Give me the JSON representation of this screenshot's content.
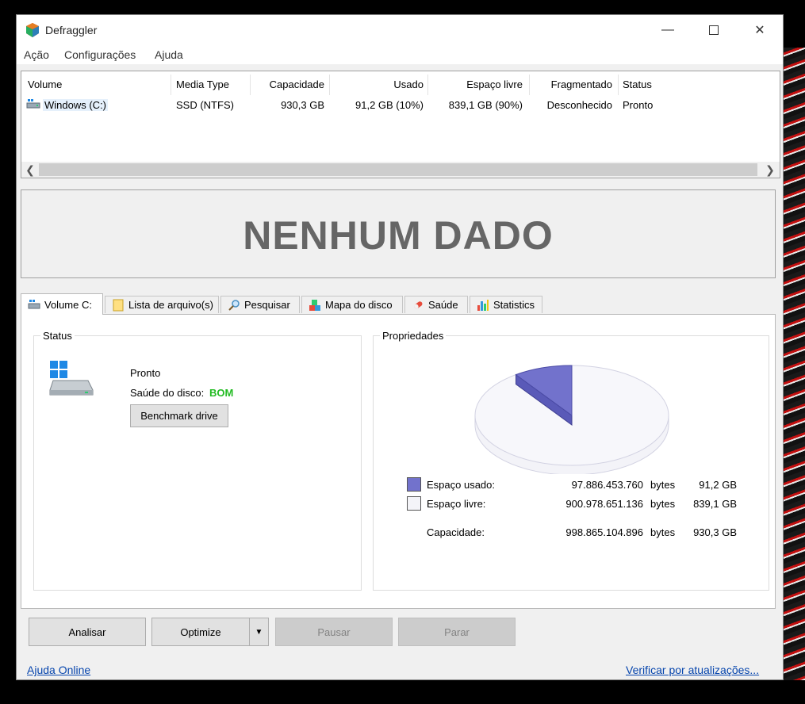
{
  "window": {
    "title": "Defraggler"
  },
  "menu": [
    "Ação",
    "Configurações",
    "Ajuda"
  ],
  "volume_list": {
    "columns": [
      "Volume",
      "Media Type",
      "Capacidade",
      "Usado",
      "Espaço livre",
      "Fragmentado",
      "Status"
    ],
    "rows": [
      {
        "volume": "Windows (C:)",
        "media_type": "SSD (NTFS)",
        "capacity": "930,3 GB",
        "used": "91,2 GB (10%)",
        "free": "839,1 GB (90%)",
        "fragmented": "Desconhecido",
        "status": "Pronto"
      }
    ]
  },
  "drive_map": {
    "message": "NENHUM DADO"
  },
  "tabs": [
    "Volume C:",
    "Lista de arquivo(s)",
    "Pesquisar",
    "Mapa do disco",
    "Saúde",
    "Statistics"
  ],
  "status_group": {
    "title": "Status",
    "state": "Pronto",
    "health_label": "Saúde do disco:",
    "health_value": "BOM",
    "benchmark_button": "Benchmark drive"
  },
  "properties_group": {
    "title": "Propriedades",
    "used": {
      "label": "Espaço usado:",
      "bytes": "97.886.453.760",
      "unit": "bytes",
      "size": "91,2 GB",
      "fraction": 0.098
    },
    "free": {
      "label": "Espaço livre:",
      "bytes": "900.978.651.136",
      "unit": "bytes",
      "size": "839,1 GB"
    },
    "capacity": {
      "label": "Capacidade:",
      "bytes": "998.865.104.896",
      "unit": "bytes",
      "size": "930,3 GB"
    }
  },
  "buttons": {
    "analyze": "Analisar",
    "optimize": "Optimize",
    "pause": "Pausar",
    "stop": "Parar"
  },
  "footer": {
    "help_link": "Ajuda Online",
    "update_link": "Verificar por atualizações..."
  },
  "colors": {
    "used": "#7272cc",
    "health_good": "#22bb22",
    "link": "#0645ad"
  }
}
